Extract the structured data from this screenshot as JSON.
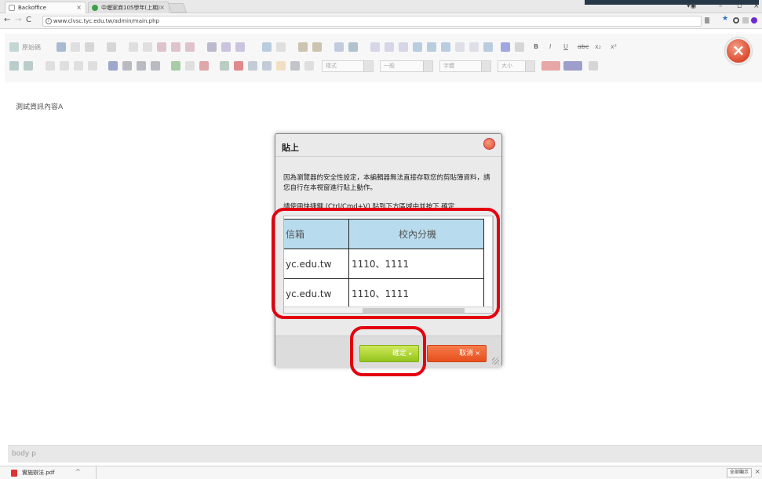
{
  "browser": {
    "tabs": [
      {
        "label": "Backoffice",
        "close": "×"
      },
      {
        "label": "中壢家商105學年(上期)",
        "close": "×"
      }
    ],
    "url": "www.clvsc.tyc.edu.tw/admin/main.php",
    "window_controls": [
      "–",
      "▫",
      "×"
    ]
  },
  "toolbar": {
    "source_label": "原始碼",
    "format_label": "樣式",
    "block_label": "一般",
    "font_label": "字體",
    "size_label": "大小"
  },
  "editor": {
    "content_text": "測試資訊內容A",
    "status_path": "body  p"
  },
  "dialog": {
    "title": "貼上",
    "message": "因為瀏覽器的安全性設定，本編輯器無法直接存取您的剪貼簿資料，請您自行在本視窗進行貼上動作。",
    "instruction": "請使用快捷鍵 (Ctrl/Cmd+V) 貼到下方區域中並按下 確定",
    "table": {
      "headers": [
        "信箱",
        "校內分機"
      ],
      "rows": [
        [
          "yc.edu.tw",
          "1110、1111"
        ],
        [
          "yc.edu.tw",
          "1110、1111"
        ]
      ]
    },
    "ok_label": "確定",
    "cancel_label": "取消"
  },
  "downloads": {
    "file": "實施辦法.pdf",
    "show_all": "全部顯示"
  },
  "colors": {
    "highlight": "#e3000f",
    "ok_button": "#9ccc22",
    "cancel_button": "#ea5a27",
    "table_header": "#b8dced"
  }
}
